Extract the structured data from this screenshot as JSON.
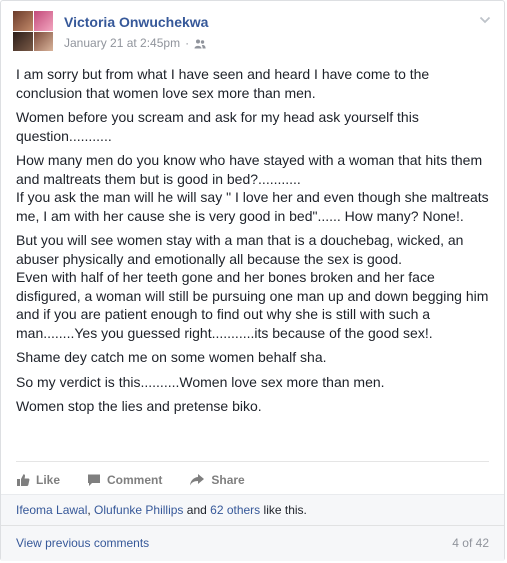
{
  "post": {
    "author": "Victoria Onwuchekwa",
    "timestamp": "January 21 at 2:45pm",
    "separator": "·",
    "audience_icon": "friends-icon",
    "menu_icon": "chevron-down-icon",
    "paragraphs": [
      "I am sorry but from what I have seen and heard I have come to the conclusion that women love sex more than men.",
      "Women before you scream and ask for my head ask yourself this question...........",
      "How many men do you know who have stayed with a woman that hits them and maltreats them but is good in bed?...........\nIf you ask the man will he will say \" I love her and even though she maltreats me, I am with her cause she is very good in bed\"...... How many? None!.",
      "But you will see women stay with a man that is a douchebag, wicked, an abuser physically and emotionally all because the sex is good.\nEven with half of her teeth gone and her bones broken and her face disfigured, a woman will still be pursuing one man up and down begging him and if you are patient enough to find out why she is still with such a man........Yes you guessed right...........its because of the good sex!.",
      "Shame dey catch me on some women behalf sha.",
      "So my verdict is this..........Women love sex more than men.",
      "Women stop the lies and pretense biko."
    ]
  },
  "actions": {
    "like": "Like",
    "comment": "Comment",
    "share": "Share"
  },
  "likes": {
    "name1": "Ifeoma Lawal",
    "sep": ", ",
    "name2": "Olufunke Phillips",
    "and": " and ",
    "others": "62 others",
    "suffix": " like this."
  },
  "comments": {
    "view_previous": "View previous comments",
    "count": "4 of 42"
  },
  "colors": {
    "link": "#365899",
    "meta": "#90949c",
    "text": "#1d2129"
  }
}
